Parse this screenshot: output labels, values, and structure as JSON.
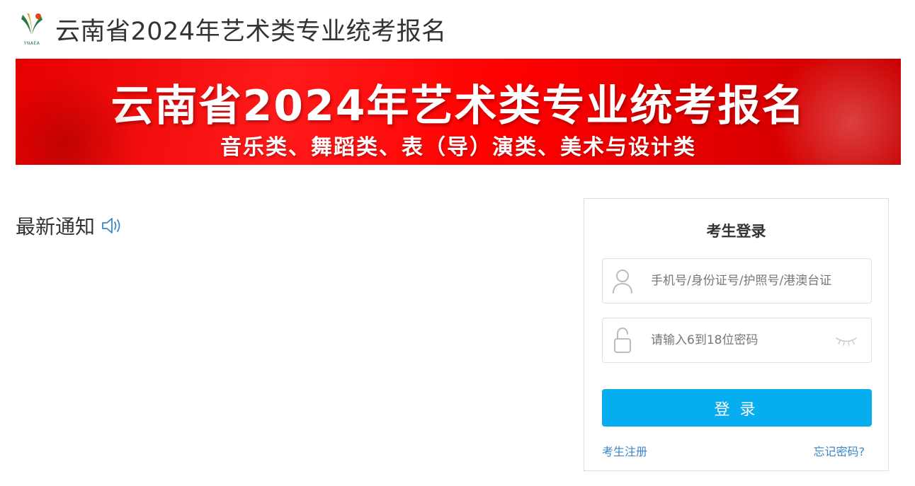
{
  "header": {
    "logo_text": "YNAEA",
    "title": "云南省2024年艺术类专业统考报名"
  },
  "banner": {
    "title": "云南省2024年艺术类专业统考报名",
    "subtitle": "音乐类、舞蹈类、表（导）演类、美术与设计类"
  },
  "notice": {
    "title": "最新通知",
    "icon": "speaker-icon"
  },
  "login": {
    "title": "考生登录",
    "username_placeholder": "手机号/身份证号/护照号/港澳台证",
    "username_value": "",
    "password_placeholder": "请输入6到18位密码",
    "password_value": "",
    "login_label": "登录",
    "register_label": "考生注册",
    "forgot_label": "忘记密码?"
  },
  "colors": {
    "banner_red": "#ff0000",
    "button_blue": "#06aef0",
    "link_blue": "#3a86c8"
  }
}
